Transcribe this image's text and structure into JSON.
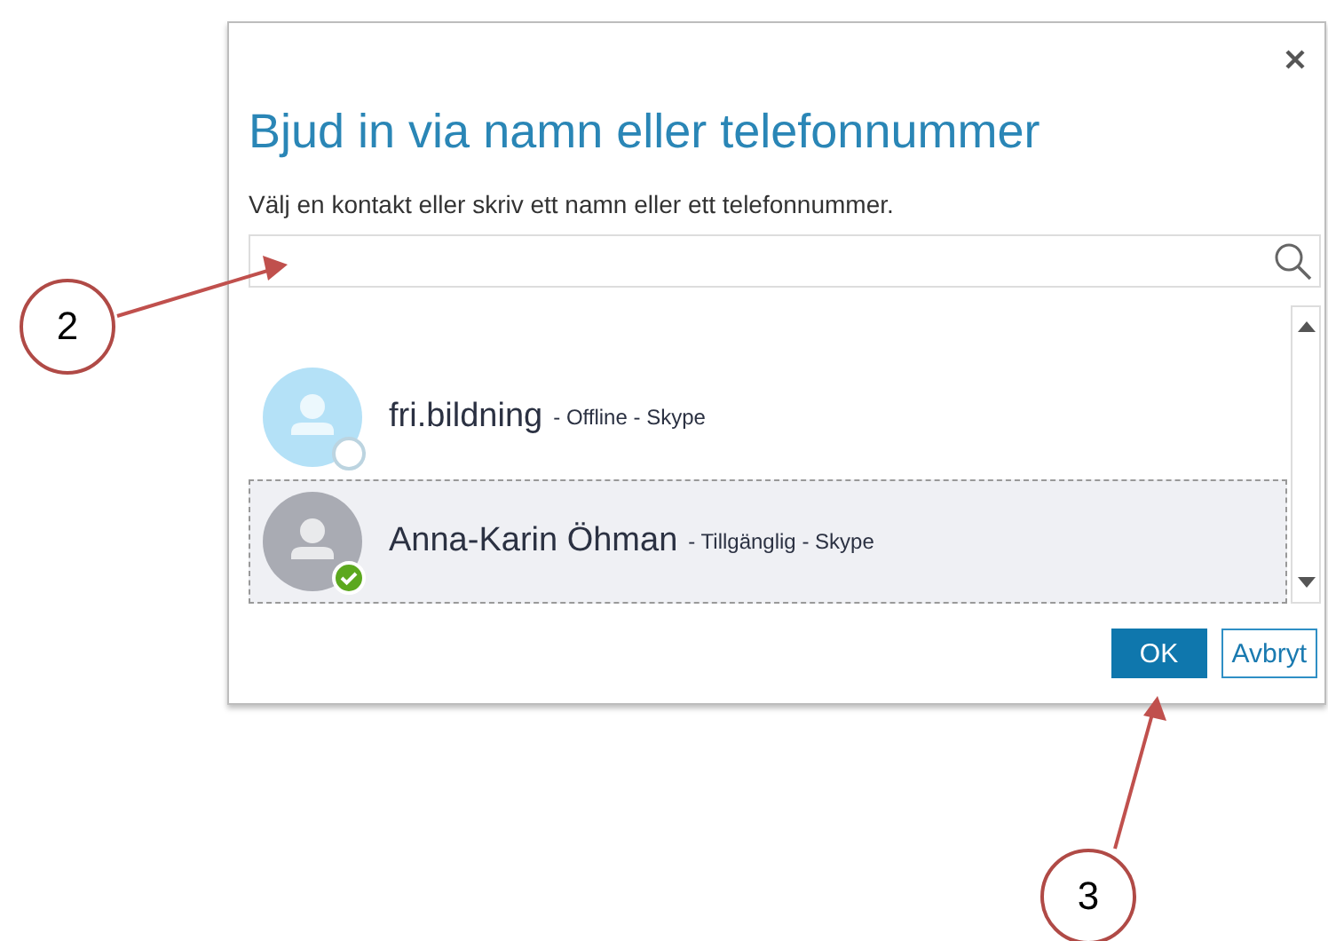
{
  "dialog": {
    "title": "Bjud in via namn eller telefonnummer",
    "instruction": "Välj en kontakt eller skriv ett namn eller ett telefonnummer.",
    "contacts": [
      {
        "name": "fri.bildning",
        "detail": "- Offline - Skype",
        "kind": "offline",
        "selected": false
      },
      {
        "name": "Anna-Karin Öhman",
        "detail": "- Tillgänglig - Skype",
        "kind": "available",
        "selected": true
      }
    ],
    "buttons": [
      {
        "label": "OK",
        "kind": "primary"
      },
      {
        "label": "Avbryt",
        "kind": "secondary"
      }
    ]
  },
  "callouts": [
    {
      "number": "2"
    },
    {
      "number": "3"
    }
  ]
}
